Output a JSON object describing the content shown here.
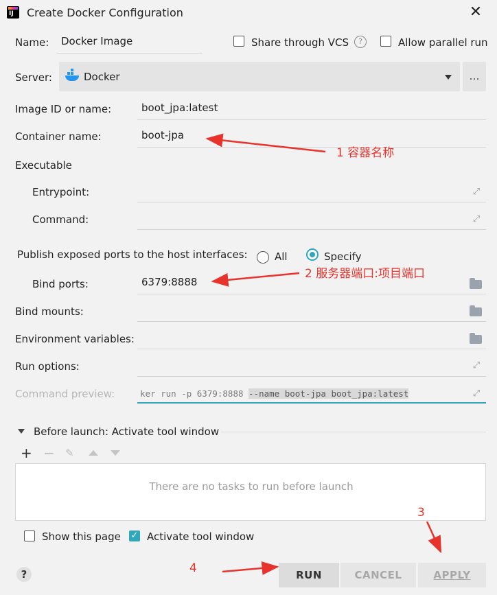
{
  "window": {
    "title": "Create Docker Configuration"
  },
  "name": {
    "label": "Name:",
    "value": "Docker Image"
  },
  "share_vcs": {
    "label": "Share through VCS"
  },
  "allow_parallel": {
    "label": "Allow parallel run"
  },
  "server": {
    "label": "Server:",
    "value": "Docker"
  },
  "image": {
    "label": "Image ID or name:",
    "value": "boot_jpa:latest"
  },
  "container": {
    "label": "Container name:",
    "value": "boot-jpa"
  },
  "executable": {
    "label": "Executable",
    "entrypoint_label": "Entrypoint:",
    "command_label": "Command:"
  },
  "publish": {
    "label": "Publish exposed ports to the host interfaces:",
    "all": "All",
    "specify": "Specify"
  },
  "bind_ports": {
    "label": "Bind ports:",
    "value": "6379:8888"
  },
  "bind_mounts": {
    "label": "Bind mounts:"
  },
  "env_vars": {
    "label": "Environment variables:"
  },
  "run_options": {
    "label": "Run options:"
  },
  "command_preview": {
    "label": "Command preview:",
    "value_plain": "ker run -p 6379:8888 ",
    "value_highlight": "--name boot-jpa boot_jpa:latest"
  },
  "before_launch": {
    "title": "Before launch: Activate tool window",
    "empty": "There are no tasks to run before launch"
  },
  "footer": {
    "show_page": "Show this page",
    "activate_tool": "Activate tool window"
  },
  "buttons": {
    "run": "RUN",
    "cancel": "CANCEL",
    "apply": "APPLY",
    "help": "?"
  },
  "annotations": {
    "a1": "1 容器名称",
    "a2": "2 服务器端口:项目端口",
    "a3": "3",
    "a4": "4"
  },
  "colors": {
    "accent": "#2fa7bd",
    "annotation": "#e8322c"
  }
}
